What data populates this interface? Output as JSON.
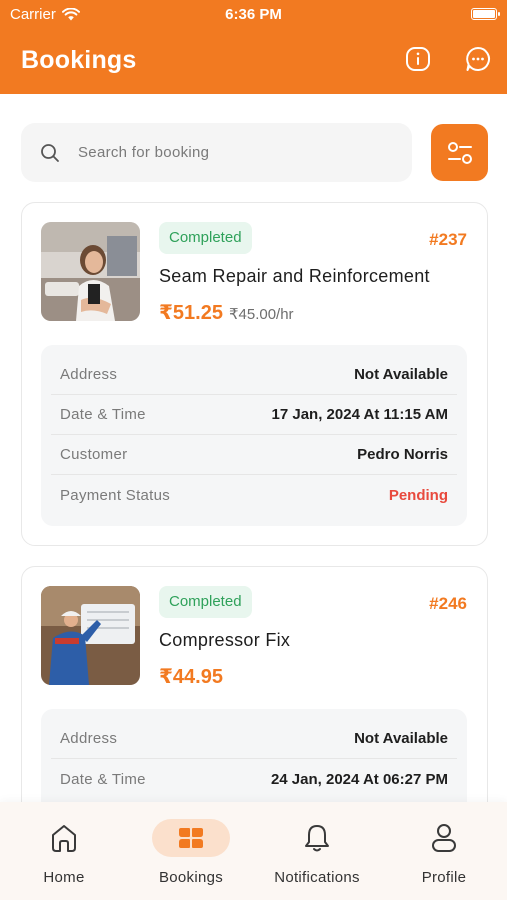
{
  "status_bar": {
    "carrier": "Carrier",
    "time": "6:36 PM"
  },
  "header": {
    "title": "Bookings",
    "info_icon": "info-circle-icon",
    "chat_icon": "chat-bubble-icon"
  },
  "search": {
    "placeholder": "Search for booking",
    "icon": "search-icon",
    "filter_icon": "filter-toggles-icon"
  },
  "bookings": [
    {
      "status": "Completed",
      "id": "#237",
      "service": "Seam Repair and Reinforcement",
      "price": "₹51.25",
      "hourly": "₹45.00/hr",
      "details": [
        {
          "label": "Address",
          "value": "Not Available"
        },
        {
          "label": "Date & Time",
          "value": "17 Jan, 2024 At 11:15 AM"
        },
        {
          "label": "Customer",
          "value": "Pedro Norris"
        },
        {
          "label": "Payment Status",
          "value": "Pending"
        }
      ]
    },
    {
      "status": "Completed",
      "id": "#246",
      "service": "Compressor Fix",
      "price": "₹44.95",
      "details": [
        {
          "label": "Address",
          "value": "Not Available"
        },
        {
          "label": "Date & Time",
          "value": "24 Jan, 2024 At 06:27 PM"
        }
      ]
    }
  ],
  "nav": {
    "items": [
      {
        "label": "Home",
        "icon": "home-icon"
      },
      {
        "label": "Bookings",
        "icon": "bookings-grid-icon",
        "active": true
      },
      {
        "label": "Notifications",
        "icon": "bell-icon"
      },
      {
        "label": "Profile",
        "icon": "profile-icon"
      }
    ]
  },
  "colors": {
    "accent": "#f27a21",
    "completed": "#2fa15a",
    "pending": "#e8493d"
  }
}
